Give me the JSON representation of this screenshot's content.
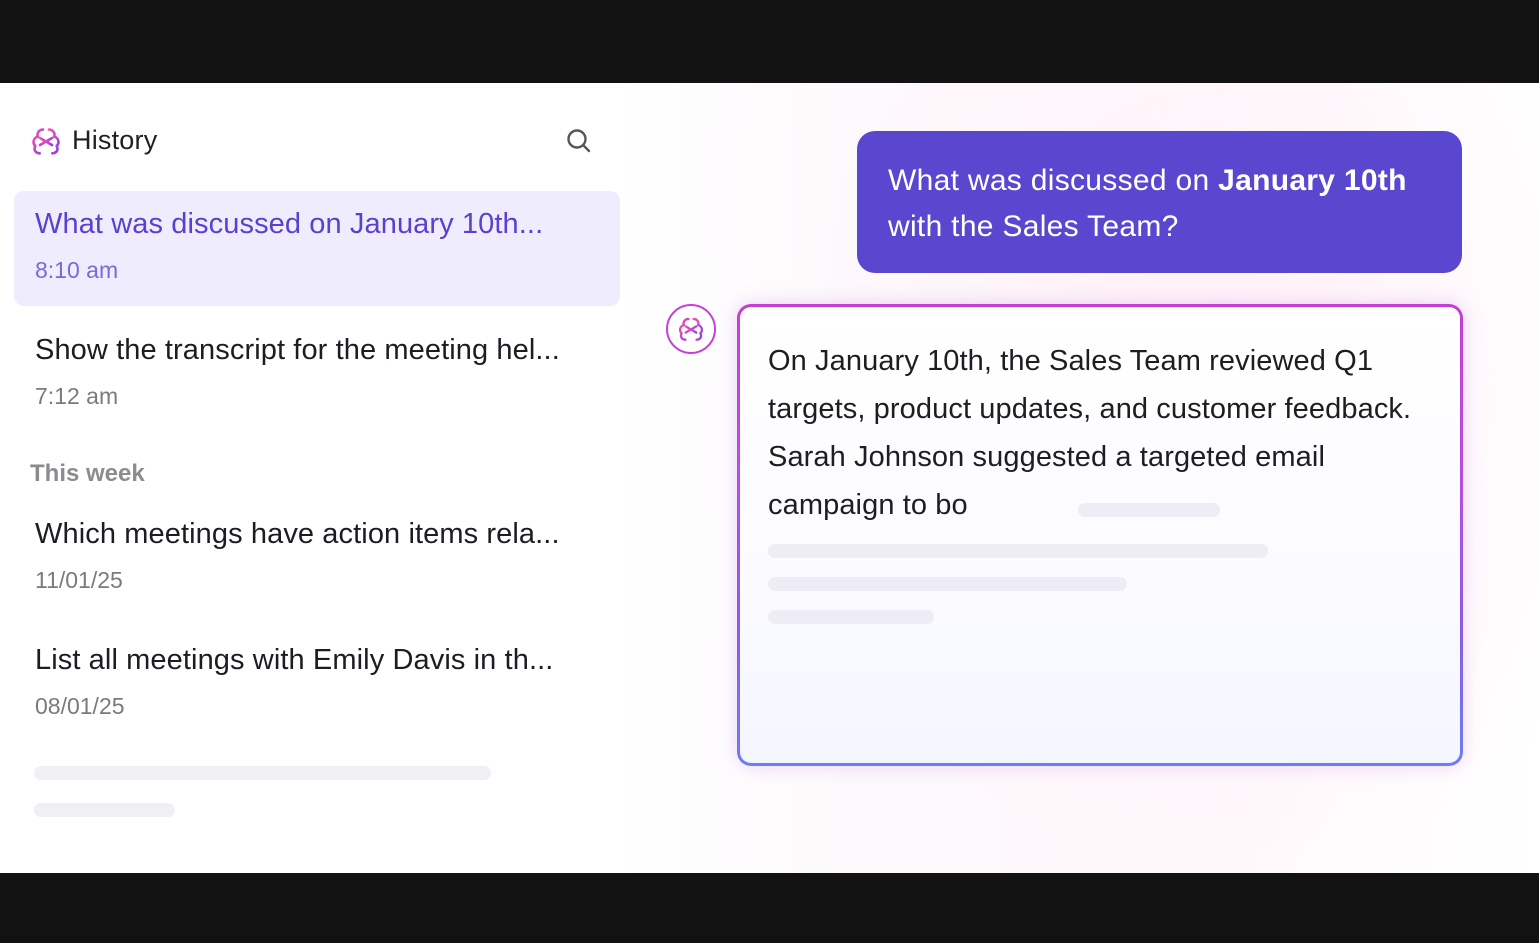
{
  "sidebar": {
    "title": "History",
    "brand_icon": "ai-brain-icon",
    "search_icon": "search-icon",
    "items": [
      {
        "title": "What was discussed on January 10th...",
        "time": "8:10 am",
        "active": true
      },
      {
        "title": "Show the transcript for the meeting hel...",
        "time": "7:12 am",
        "active": false
      }
    ],
    "section_label": "This week",
    "week_items": [
      {
        "title": "Which meetings have action items rela...",
        "time": "11/01/25"
      },
      {
        "title": "List all meetings with Emily Davis in th...",
        "time": "08/01/25"
      }
    ]
  },
  "chat": {
    "user_message": {
      "part1": "What was discussed on ",
      "bold": "January 10th",
      "part2": " with the Sales Team?"
    },
    "ai_avatar_icon": "ai-brain-icon",
    "answer_text": "On January 10th, the Sales Team reviewed Q1 targets, product updates, and customer feedback. Sarah Johnson suggested a targeted email campaign to bo"
  },
  "colors": {
    "accent": "#5a47cf",
    "active_bg": "#efedfd",
    "active_text": "#5a3fd1",
    "gradient_pink": "#c33fd3",
    "gradient_blue": "#6c7ef0"
  }
}
